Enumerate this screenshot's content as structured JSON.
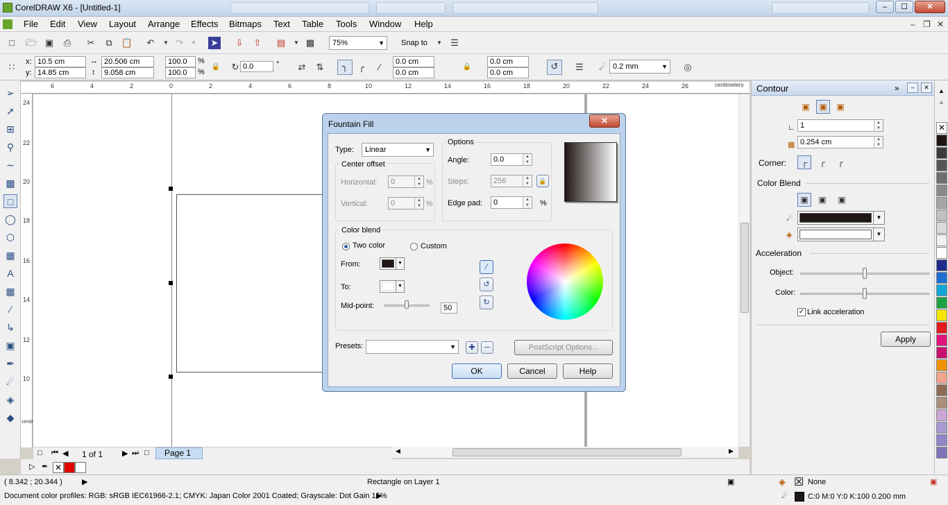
{
  "window": {
    "title": "CorelDRAW X6 - [Untitled-1]",
    "minimize": "–",
    "maximize": "☐",
    "close": "✕"
  },
  "menu": [
    "File",
    "Edit",
    "View",
    "Layout",
    "Arrange",
    "Effects",
    "Bitmaps",
    "Text",
    "Table",
    "Tools",
    "Window",
    "Help"
  ],
  "standard_toolbar": {
    "zoom": "75%",
    "snap_to": "Snap to"
  },
  "property_bar": {
    "x_label": "x:",
    "x_value": "10.5 cm",
    "y_label": "y:",
    "y_value": "14.85 cm",
    "width_value": "20.506 cm",
    "height_value": "9.058 cm",
    "scale_x": "100.0",
    "scale_y": "100.0",
    "percent": "%",
    "rotation": "0.0",
    "degree": "°",
    "corner_1": "0.0 cm",
    "corner_2": "0.0 cm",
    "corner_3": "0.0 cm",
    "corner_4": "0.0 cm",
    "outline_width": "0.2 mm"
  },
  "ruler": {
    "units": "centimeters",
    "h_ticks": [
      "6",
      "4",
      "2",
      "0",
      "2",
      "4",
      "6",
      "8",
      "10",
      "12",
      "14",
      "16",
      "18",
      "20",
      "22",
      "24",
      "26"
    ],
    "v_ticks": [
      "24",
      "22",
      "20",
      "18",
      "16",
      "14",
      "12",
      "10"
    ],
    "v_units": "centimeters"
  },
  "page_nav": {
    "page_count": "1 of 1",
    "page_tab": "Page 1"
  },
  "status": {
    "coords": "( 8.342 ; 20.344 )",
    "object_info": "Rectangle on Layer 1",
    "color_profiles": "Document color profiles: RGB: sRGB IEC61966-2.1; CMYK: Japan Color 2001 Coated; Grayscale: Dot Gain 15%",
    "fill_label": "None",
    "outline_label": "C:0 M:0 Y:0 K:100  0.200 mm"
  },
  "docker": {
    "title": "Contour",
    "steps": "1",
    "offset": "0.254 cm",
    "corner_label": "Corner:",
    "color_blend_label": "Color Blend",
    "acceleration_label": "Acceleration",
    "object_label": "Object:",
    "color_label": "Color:",
    "link_acceleration": "Link acceleration",
    "apply": "Apply",
    "outline_color": "#201715",
    "fill_color": "#ffffff",
    "object_acceleration": 0.5,
    "color_acceleration": 0.5
  },
  "dialog": {
    "title": "Fountain Fill",
    "type_label": "Type:",
    "type_value": "Linear",
    "center_offset_label": "Center offset",
    "horizontal_label": "Horizontal:",
    "horizontal_value": "0",
    "vertical_label": "Vertical:",
    "vertical_value": "0",
    "percent": "%",
    "options_label": "Options",
    "angle_label": "Angle:",
    "angle_value": "0.0",
    "steps_label": "Steps:",
    "steps_value": "256",
    "edge_pad_label": "Edge pad:",
    "edge_pad_value": "0",
    "color_blend_label": "Color blend",
    "two_color_label": "Two color",
    "custom_label": "Custom",
    "from_label": "From:",
    "to_label": "To:",
    "midpoint_label": "Mid-point:",
    "midpoint_value": "50",
    "presets_label": "Presets:",
    "postscript_button": "PostScript Options...",
    "ok": "OK",
    "cancel": "Cancel",
    "help": "Help",
    "from_color": "#201715",
    "to_color": "#ffffff"
  },
  "palette_colors": [
    "#201715",
    "#3b3b3b",
    "#555555",
    "#6e6e6e",
    "#8a8a8a",
    "#a5a5a5",
    "#c0c0c0",
    "#dadada",
    "#f2f2f2",
    "#ffffff",
    "#1c2a8a",
    "#1f6fd0",
    "#14a6d8",
    "#1aa33e",
    "#f5e400",
    "#e21b1b",
    "#e0137a",
    "#c8106f",
    "#f39200",
    "#f0a58c",
    "#8d6c53",
    "#a88f7a",
    "#c9a6d4",
    "#a89ad1",
    "#8f86c9",
    "#7e74b8"
  ],
  "swatch_bar": {
    "fill_color": "#e00000",
    "outline_color": "#ffffff"
  }
}
